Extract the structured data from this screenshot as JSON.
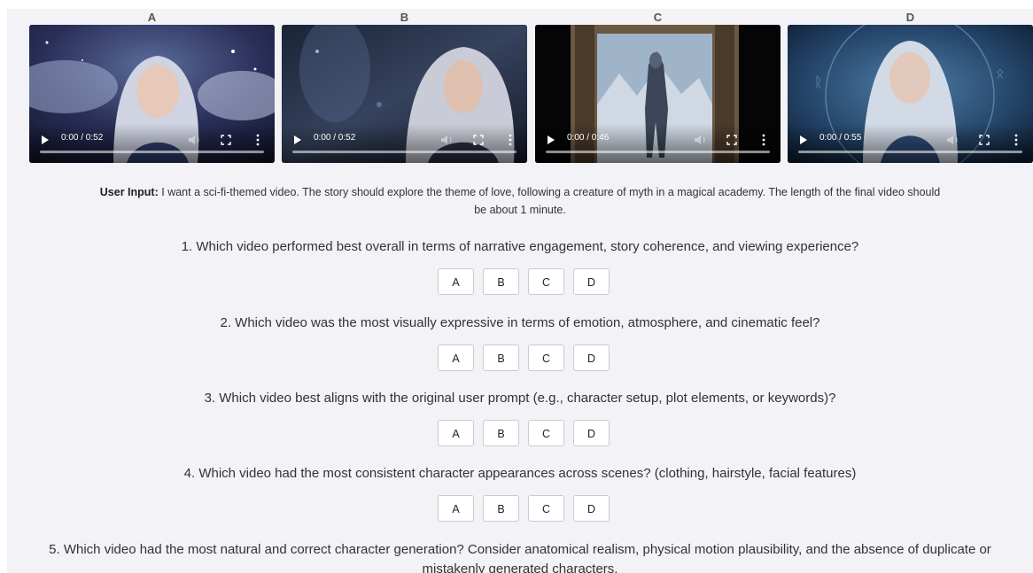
{
  "videos": [
    {
      "label": "A",
      "time": "0:00 / 0:52",
      "progress": 0
    },
    {
      "label": "B",
      "time": "0:00 / 0:52",
      "progress": 0
    },
    {
      "label": "C",
      "time": "0:00 / 0:46",
      "progress": 0
    },
    {
      "label": "D",
      "time": "0:00 / 0:55",
      "progress": 0
    }
  ],
  "user_input": {
    "prefix": "User Input:",
    "text": "I want a sci-fi-themed video. The story should explore the theme of love, following a creature of myth in a magical academy. The length of the final video should be about 1 minute."
  },
  "questions": [
    {
      "text": "1. Which video performed best overall in terms of narrative engagement, story coherence, and viewing experience?",
      "options": [
        "A",
        "B",
        "C",
        "D"
      ]
    },
    {
      "text": "2. Which video was the most visually expressive in terms of emotion, atmosphere, and cinematic feel?",
      "options": [
        "A",
        "B",
        "C",
        "D"
      ]
    },
    {
      "text": "3. Which video best aligns with the original user prompt (e.g., character setup, plot elements, or keywords)?",
      "options": [
        "A",
        "B",
        "C",
        "D"
      ]
    },
    {
      "text": "4. Which video had the most consistent character appearances across scenes? (clothing, hairstyle, facial features)",
      "options": [
        "A",
        "B",
        "C",
        "D"
      ]
    },
    {
      "text": "5. Which video had the most natural and correct character generation? Consider anatomical realism, physical motion plausibility, and the absence of duplicate or mistakenly generated characters."
    }
  ],
  "icons": [
    "play-icon",
    "volume-icon",
    "fullscreen-icon",
    "more-vertical-icon"
  ]
}
